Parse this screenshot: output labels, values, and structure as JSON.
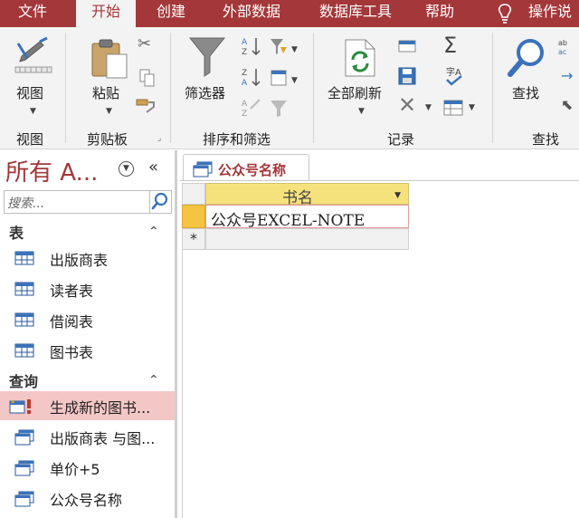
{
  "ribbon_tabs": [
    "文件",
    "开始",
    "创建",
    "外部数据",
    "数据库工具",
    "帮助",
    "操作说"
  ],
  "active_tab": "开始",
  "ribbon": {
    "view_label": "视图",
    "paste_label": "粘贴",
    "filter_label": "筛选器",
    "refresh_label": "全部刷新",
    "find_label": "查找",
    "groups": {
      "view": "视图",
      "clipboard": "剪贴板",
      "sort_filter": "排序和筛选",
      "records": "记录",
      "find": "查找"
    }
  },
  "nav": {
    "title": "所有 A...",
    "search_placeholder": "搜索...",
    "sections": [
      {
        "label": "表",
        "items": [
          "出版商表",
          "读者表",
          "借阅表",
          "图书表"
        ]
      },
      {
        "label": "查询",
        "items": [
          "生成新的图书...",
          "出版商表 与图...",
          "单价+5",
          "公众号名称"
        ]
      }
    ]
  },
  "document": {
    "tab_title": "公众号名称",
    "column_header": "书名",
    "rows": [
      "公众号EXCEL-NOTE"
    ],
    "new_row_marker": "*"
  },
  "colors": {
    "brand": "#a4373a",
    "header_fill": "#f6e27d",
    "selected_item": "#f4c7c7"
  }
}
